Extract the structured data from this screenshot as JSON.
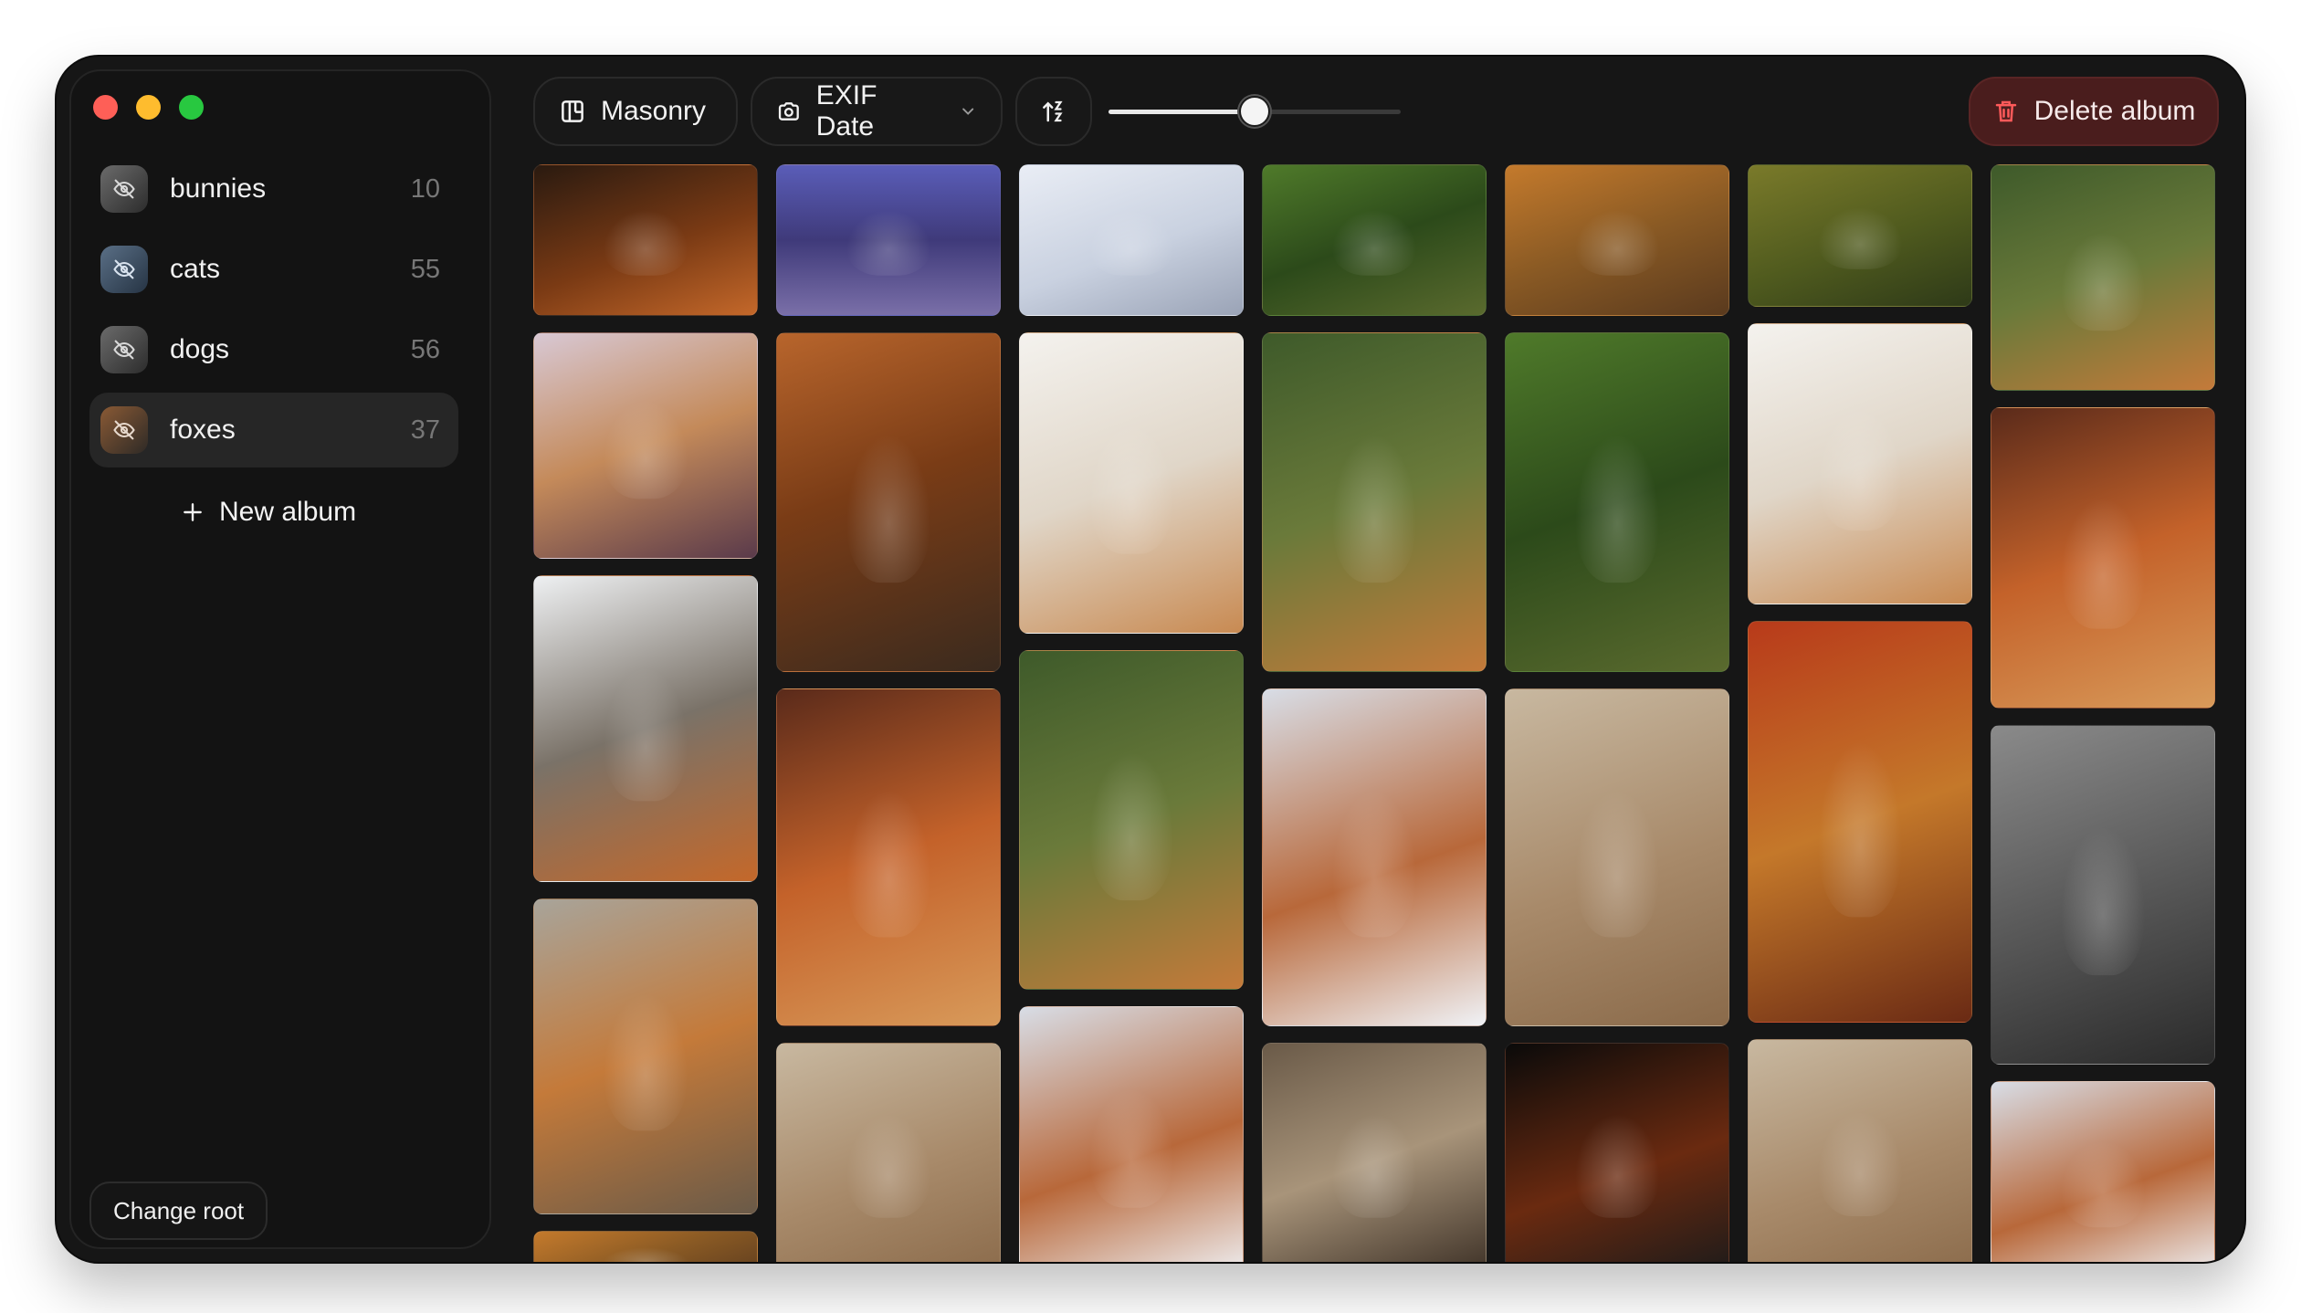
{
  "window": {
    "traffic_lights": [
      "close",
      "minimize",
      "maximize"
    ]
  },
  "sidebar": {
    "albums": [
      {
        "name": "bunnies",
        "count": "10",
        "icon": "eye-slash-icon",
        "active": false
      },
      {
        "name": "cats",
        "count": "55",
        "icon": "eye-slash-icon",
        "active": false
      },
      {
        "name": "dogs",
        "count": "56",
        "icon": "eye-slash-icon",
        "active": false
      },
      {
        "name": "foxes",
        "count": "37",
        "icon": "eye-slash-icon",
        "active": true
      }
    ],
    "new_album_label": "New album",
    "change_root_label": "Change root"
  },
  "toolbar": {
    "layout_label": "Masonry",
    "layout_icon": "columns-icon",
    "sort_field_label": "EXIF Date",
    "sort_field_icon": "camera-icon",
    "sort_order_icon": "sort-ascending-icon",
    "zoom_level": 0.5,
    "delete_label": "Delete album",
    "delete_icon": "trash-icon",
    "delete_color": "#4a1d1d"
  },
  "gallery": {
    "album": "foxes",
    "columns": 7
  }
}
